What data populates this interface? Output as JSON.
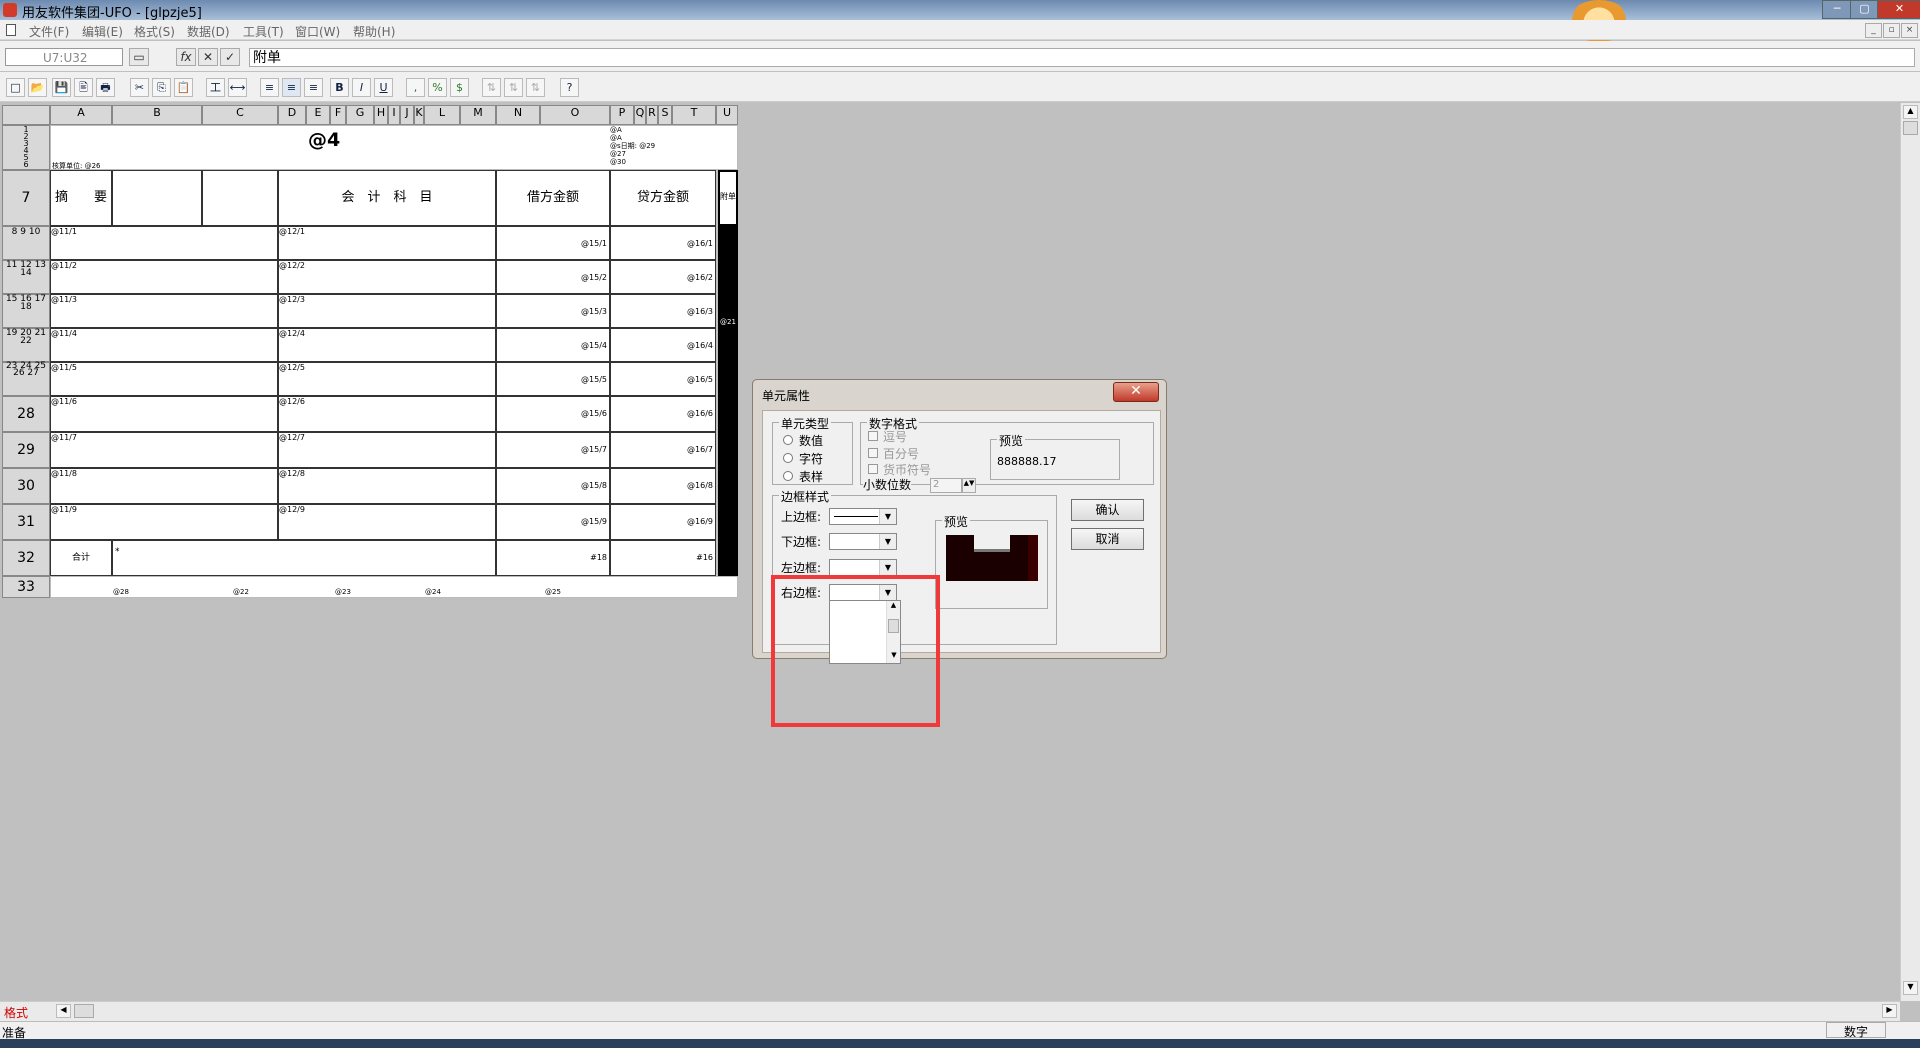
{
  "window": {
    "title": "用友软件集团-UFO - [glpzje5]",
    "controls": [
      "─",
      "▢",
      "✕"
    ]
  },
  "menu": [
    "文件(F)",
    "编辑(E)",
    "格式(S)",
    "数据(D)",
    "工具(T)",
    "窗口(W)",
    "帮助(H)"
  ],
  "formula_bar": {
    "cell_ref": "U7:U32",
    "fx": "fx",
    "cancel": "✕",
    "ok": "✓",
    "content": "附单"
  },
  "toolbar": [
    "□",
    "📂",
    "💾",
    "🖹",
    "🖶",
    "✂",
    "⎘",
    "📋",
    "工",
    "⟷",
    "≡",
    "≡",
    "≡",
    "B",
    "I",
    "U",
    ",",
    "%",
    "$",
    "⇅",
    "⇅",
    "⇅",
    "?"
  ],
  "columns": [
    "A",
    "B",
    "C",
    "D",
    "E",
    "F",
    "G",
    "H",
    "I",
    "J",
    "K",
    "L",
    "M",
    "N",
    "O",
    "P",
    "Q",
    "R",
    "S",
    "T",
    "U"
  ],
  "sheet": {
    "title": "@4",
    "small_rows": [
      "1",
      "2",
      "3",
      "4",
      "5",
      "6"
    ],
    "right_notes": [
      "@A",
      "@A",
      "@s日期:  @29",
      "@27",
      "@30"
    ],
    "left_note": "核算单位: @26",
    "header": {
      "row_label": "7",
      "summary": "摘　　要",
      "account": "会　计　科　目",
      "debit": "借方金额",
      "credit": "贷方金额",
      "attach": "附单"
    },
    "rows": [
      {
        "label": "8 9 10",
        "a": "@11/1",
        "d": "@12/1",
        "o": "@15/1",
        "t": "@16/1"
      },
      {
        "label": "11 12 13 14",
        "a": "@11/2",
        "d": "@12/2",
        "o": "@15/2",
        "t": "@16/2"
      },
      {
        "label": "15 16 17 18",
        "a": "@11/3",
        "d": "@12/3",
        "o": "@15/3",
        "t": "@16/3"
      },
      {
        "label": "19 20 21 22",
        "a": "@11/4",
        "d": "@12/4",
        "o": "@15/4",
        "t": "@16/4"
      },
      {
        "label": "23 24 25 26 27",
        "a": "@11/5",
        "d": "@12/5",
        "o": "@15/5",
        "t": "@16/5"
      },
      {
        "label": "28",
        "a": "@11/6",
        "d": "@12/6",
        "o": "@15/6",
        "t": "@16/6"
      },
      {
        "label": "29",
        "a": "@11/7",
        "d": "@12/7",
        "o": "@15/7",
        "t": "@16/7"
      },
      {
        "label": "30",
        "a": "@11/8",
        "d": "@12/8",
        "o": "@15/8",
        "t": "@16/8"
      },
      {
        "label": "31",
        "a": "@11/9",
        "d": "@12/9",
        "o": "@15/9",
        "t": "@16/9"
      }
    ],
    "total": {
      "label": "32",
      "text": "合计",
      "star": "*",
      "o": "#18",
      "t": "#16"
    },
    "footer": {
      "label": "33",
      "b": "@28",
      "c": "@22",
      "d": "@23",
      "l": "@24",
      "o": "@25"
    },
    "attach_note": "@21"
  },
  "sheet_tab": "格式",
  "status": {
    "left": "准备",
    "right": "数字"
  },
  "dialog": {
    "title": "单元属性",
    "close": "✕",
    "cell_type": {
      "label": "单元类型",
      "options": [
        "数值",
        "字符",
        "表样"
      ]
    },
    "number_format": {
      "label": "数字格式",
      "options": [
        "逗号",
        "百分号",
        "货币符号"
      ],
      "decimals_label": "小数位数",
      "decimals_value": "2",
      "preview_label": "预览",
      "preview_value": "888888.17"
    },
    "border": {
      "label": "边框样式",
      "top": "上边框:",
      "bottom": "下边框:",
      "left": "左边框:",
      "right": "右边框:",
      "preview_label": "预览"
    },
    "ok": "确认",
    "cancel": "取消"
  },
  "colors": {
    "highlight": "#f03a3a",
    "title_bar": "#8aa4c6",
    "selection": "#000000"
  }
}
